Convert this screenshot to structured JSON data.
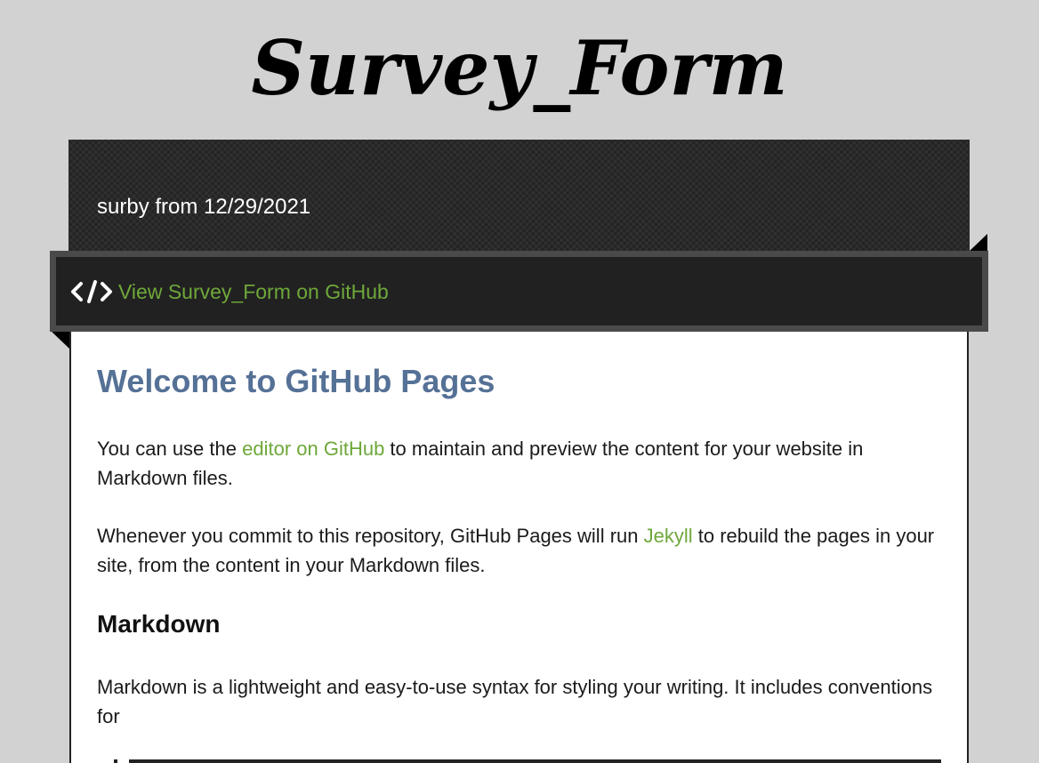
{
  "site": {
    "title": "Survey_Form",
    "subtitle": "surby from 12/29/2021"
  },
  "ribbon": {
    "icon": "code-icon",
    "link_label": "View Survey_Form on GitHub"
  },
  "content": {
    "heading": "Welcome to GitHub Pages",
    "para1": {
      "before": "You can use the ",
      "link": "editor on GitHub",
      "after": " to maintain and preview the content for your website in Markdown files."
    },
    "para2": {
      "before": "Whenever you commit to this repository, GitHub Pages will run ",
      "link": "Jekyll",
      "after": " to rebuild the pages in your site, from the content in your Markdown files."
    },
    "section_heading": "Markdown",
    "para3": "Markdown is a lightweight and easy-to-use syntax for styling your writing. It includes conventions for"
  },
  "colors": {
    "background": "#d2d2d2",
    "link": "#6ea83a",
    "heading": "#557196",
    "header_dark": "#2a2a2a"
  }
}
